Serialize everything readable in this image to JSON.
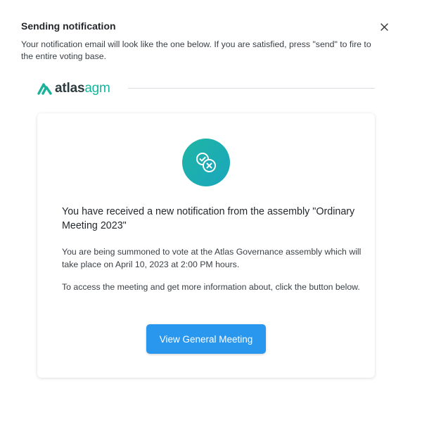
{
  "dialog": {
    "title": "Sending notification",
    "description": "Your notification email will look like the one below. If you are satisfied, press \"send\" to fire to the entire voting base.",
    "close_icon": "close-icon"
  },
  "brand": {
    "name_part1": "atlas",
    "name_part2": "agm",
    "logo_icon": "atlas-logo-icon",
    "color_primary": "#19b39b",
    "color_dark": "#2d3a3e"
  },
  "email": {
    "icon": "vote-check-cross-icon",
    "heading": "You have received a new notification from the assembly \"Ordinary Meeting 2023\"",
    "paragraph1": "You are being summoned to vote at the Atlas Governance assembly which will take place on April 10, 2023 at 2:00 PM hours.",
    "paragraph2": "To access the meeting and get more information about, click the button below.",
    "button_label": "View General Meeting",
    "button_color": "#2a97ef",
    "icon_gradient": [
      "#1fb5a4",
      "#1aa6bd"
    ]
  }
}
